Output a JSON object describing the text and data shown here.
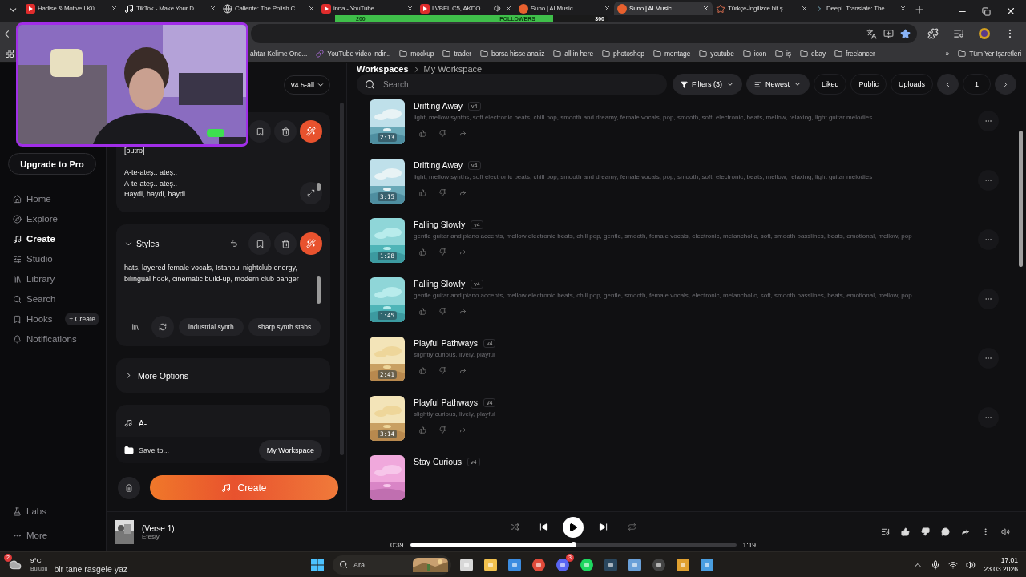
{
  "browser": {
    "tabs": [
      {
        "kind": "youtube",
        "title": "Hadise & Motive I Kü",
        "selected": false,
        "audio": false
      },
      {
        "kind": "tiktok",
        "title": "TikTok - Make Your D",
        "selected": false,
        "audio": false
      },
      {
        "kind": "globe",
        "title": "Caliente: The Polish C",
        "selected": false,
        "audio": false
      },
      {
        "kind": "youtube",
        "title": "inna - YouTube",
        "selected": false,
        "audio": false
      },
      {
        "kind": "youtube",
        "title": "LVBEL C5, AKDO",
        "selected": false,
        "audio": true
      },
      {
        "kind": "suno",
        "title": "Suno | AI Music",
        "selected": false,
        "audio": false
      },
      {
        "kind": "suno",
        "title": "Suno | AI Music",
        "selected": true,
        "audio": false
      },
      {
        "kind": "spark",
        "title": "Türkçe-İngilizce hit ş",
        "selected": false,
        "audio": false
      },
      {
        "kind": "deepl",
        "title": "DeepL Translate: The",
        "selected": false,
        "audio": false
      }
    ],
    "followers_goal": {
      "start": "200",
      "label": "FOLLOWERS",
      "end": "300",
      "level": 0.8
    },
    "bookmarks": [
      {
        "kind": "plain",
        "label": "ahtar Kelime Öne..."
      },
      {
        "kind": "link",
        "label": "YouTube video indir..."
      },
      {
        "kind": "folder",
        "label": "mockup"
      },
      {
        "kind": "folder",
        "label": "trader"
      },
      {
        "kind": "folder",
        "label": "borsa hisse analiz"
      },
      {
        "kind": "folder",
        "label": "all in here"
      },
      {
        "kind": "folder",
        "label": "photoshop"
      },
      {
        "kind": "folder",
        "label": "montage"
      },
      {
        "kind": "folder",
        "label": "youtube"
      },
      {
        "kind": "folder",
        "label": "icon"
      },
      {
        "kind": "folder",
        "label": "iş"
      },
      {
        "kind": "folder",
        "label": "ebay"
      },
      {
        "kind": "folder",
        "label": "freelancer"
      }
    ],
    "more_bookmarks": "»",
    "all_bookmarks": "Tüm Yer İşaretleri"
  },
  "sidebar": {
    "upgrade": "Upgrade to Pro",
    "nav": [
      {
        "label": "Home",
        "selected": false
      },
      {
        "label": "Explore",
        "selected": false
      },
      {
        "label": "Create",
        "selected": true
      },
      {
        "label": "Studio",
        "selected": false
      },
      {
        "label": "Library",
        "selected": false
      },
      {
        "label": "Search",
        "selected": false
      },
      {
        "label": "Hooks",
        "selected": false,
        "badge": "+ Create"
      },
      {
        "label": "Notifications",
        "selected": false
      }
    ],
    "footer": [
      {
        "label": "Labs"
      },
      {
        "label": "More"
      }
    ]
  },
  "create": {
    "model": "v4.5-all",
    "lyrics": "[outro]\n\nA-te-ateş.. ateş..\nA-te-ateş.. ateş..\nHaydi, haydi, haydi..",
    "styles_title": "Styles",
    "styles_text": "hats, layered female vocals, Istanbul nightclub energy, bilingual hook, cinematic build-up, modern club banger",
    "style_tags": [
      "industrial synth",
      "sharp synth stabs"
    ],
    "more_options": "More Options",
    "song_title": "A-",
    "save_to": "Save to...",
    "workspace": "My Workspace",
    "create_button": "Create"
  },
  "workspace": {
    "breadcrumb": [
      "Workspaces",
      "My Workspace"
    ],
    "search_placeholder": "Search",
    "filters": "Filters (3)",
    "sort": "Newest",
    "chips": [
      "Liked",
      "Public",
      "Uploads"
    ],
    "page": "1",
    "songs": [
      {
        "title": "Drifting Away",
        "version": "v4",
        "tags": "light, mellow synths, soft electronic beats, chill pop, smooth and dreamy, female vocals, pop, smooth, soft, electronic, beats, mellow, relaxing, light guitar melodies",
        "duration": "2:13"
      },
      {
        "title": "Drifting Away",
        "version": "v4",
        "tags": "light, mellow synths, soft electronic beats, chill pop, smooth and dreamy, female vocals, pop, smooth, soft, electronic, beats, mellow, relaxing, light guitar melodies",
        "duration": "3:15"
      },
      {
        "title": "Falling Slowly",
        "version": "v4",
        "tags": "gentle guitar and piano accents, mellow electronic beats, chill pop, gentle, smooth, female vocals, electronic, melancholic, soft, smooth basslines, beats, emotional, mellow, pop",
        "duration": "1:28"
      },
      {
        "title": "Falling Slowly",
        "version": "v4",
        "tags": "gentle guitar and piano accents, mellow electronic beats, chill pop, gentle, smooth, female vocals, electronic, melancholic, soft, smooth basslines, beats, emotional, mellow, pop",
        "duration": "1:45"
      },
      {
        "title": "Playful Pathways",
        "version": "v4",
        "tags": "slightly curious, lively, playful",
        "duration": "2:41"
      },
      {
        "title": "Playful Pathways",
        "version": "v4",
        "tags": "slightly curious, lively, playful",
        "duration": "3:14"
      },
      {
        "title": "Stay Curious",
        "version": "v4"
      }
    ]
  },
  "player": {
    "title": "(Verse 1)",
    "artist": "Efesly",
    "elapsed": "0:39",
    "total": "1:19",
    "level": 0.5
  },
  "taskbar": {
    "weather": {
      "badge": "2",
      "temp": "9°C",
      "condition": "Bulutlu"
    },
    "caption": "bir tane rasgele yaz",
    "search_placeholder": "Ara",
    "apps": [
      {
        "kind": "taskview"
      },
      {
        "kind": "folder"
      },
      {
        "kind": "store"
      },
      {
        "kind": "chrome"
      },
      {
        "kind": "discord",
        "badge": "3"
      },
      {
        "kind": "spotify"
      },
      {
        "kind": "steam"
      },
      {
        "kind": "cube"
      },
      {
        "kind": "obs"
      },
      {
        "kind": "audio"
      },
      {
        "kind": "notes"
      }
    ],
    "time": "17:01",
    "date": "23.03.2026"
  }
}
